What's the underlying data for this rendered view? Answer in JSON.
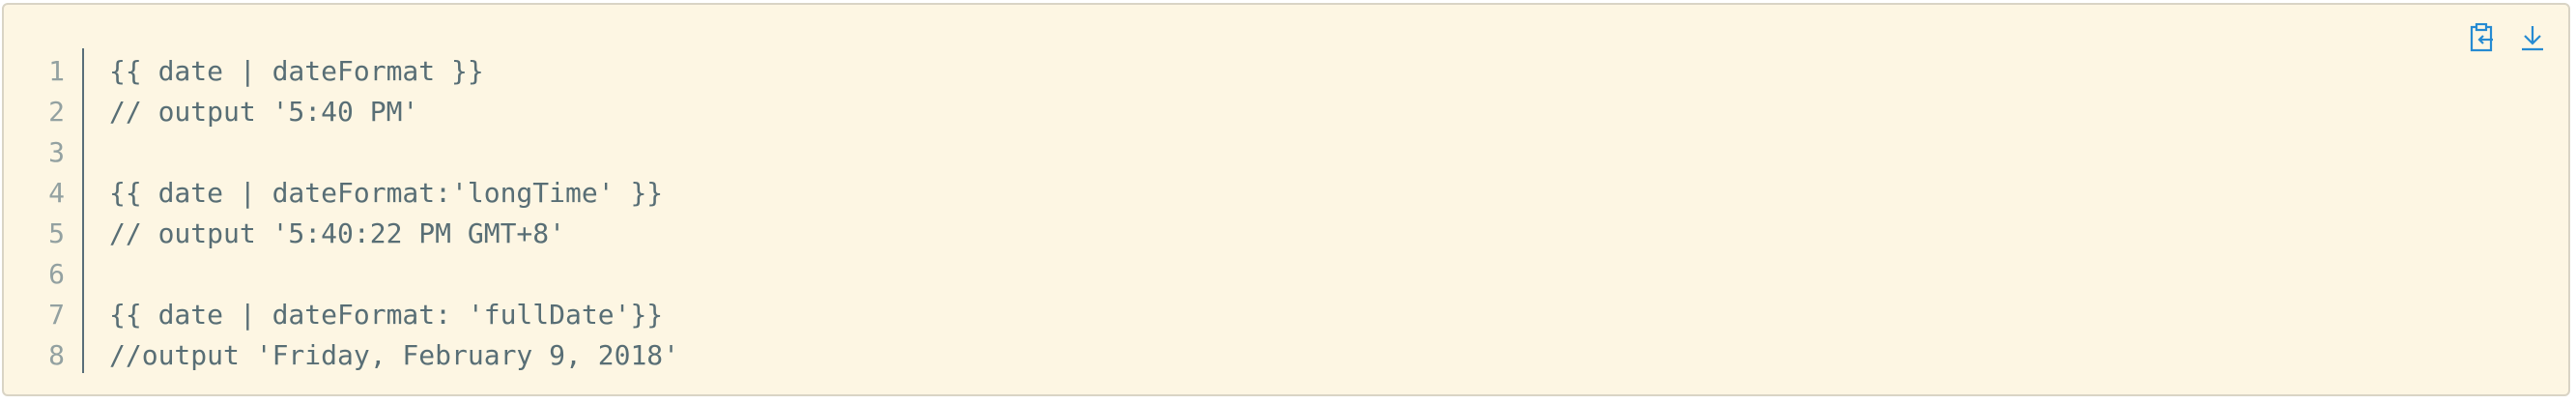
{
  "toolbar": {
    "copy_icon": "clipboard-copy-icon",
    "download_icon": "download-icon",
    "accent_color": "#268bd2"
  },
  "code": {
    "lines": [
      {
        "num": "1",
        "text": "{{ date | dateFormat }}"
      },
      {
        "num": "2",
        "text": "// output '5:40 PM'"
      },
      {
        "num": "3",
        "text": ""
      },
      {
        "num": "4",
        "text": "{{ date | dateFormat:'longTime' }}"
      },
      {
        "num": "5",
        "text": "// output '5:40:22 PM GMT+8'"
      },
      {
        "num": "6",
        "text": ""
      },
      {
        "num": "7",
        "text": "{{ date | dateFormat: 'fullDate'}}"
      },
      {
        "num": "8",
        "text": "//output 'Friday, February 9, 2018'"
      }
    ]
  },
  "colors": {
    "background": "#fdf6e3",
    "text": "#586e75",
    "line_numbers": "#93a1a1"
  }
}
